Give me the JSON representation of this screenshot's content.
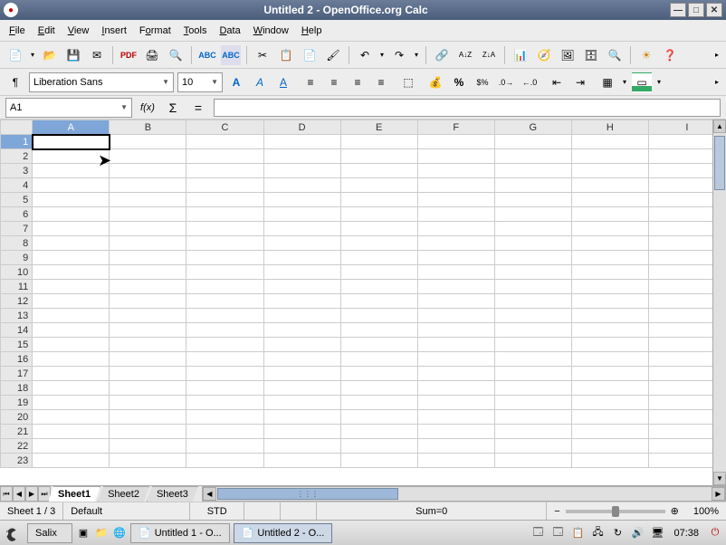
{
  "window": {
    "title": "Untitled 2 - OpenOffice.org Calc"
  },
  "menu": {
    "items": [
      "File",
      "Edit",
      "View",
      "Insert",
      "Format",
      "Tools",
      "Data",
      "Window",
      "Help"
    ]
  },
  "format": {
    "font_name": "Liberation Sans",
    "font_size": "10"
  },
  "formula": {
    "cell_ref": "A1",
    "value": ""
  },
  "grid": {
    "columns": [
      "A",
      "B",
      "C",
      "D",
      "E",
      "F",
      "G",
      "H",
      "I"
    ],
    "rows": [
      1,
      2,
      3,
      4,
      5,
      6,
      7,
      8,
      9,
      10,
      11,
      12,
      13,
      14,
      15,
      16,
      17,
      18,
      19,
      20,
      21,
      22,
      23
    ],
    "selected_col": "A",
    "selected_row": 1
  },
  "sheet_tabs": [
    "Sheet1",
    "Sheet2",
    "Sheet3"
  ],
  "active_sheet": "Sheet1",
  "status": {
    "sheet_indicator": "Sheet 1 / 3",
    "style": "Default",
    "mode": "STD",
    "sum": "Sum=0",
    "zoom": "100%"
  },
  "taskbar": {
    "distro": "Salix",
    "tasks": [
      {
        "label": "Untitled 1 - O...",
        "active": false
      },
      {
        "label": "Untitled 2 - O...",
        "active": true
      }
    ],
    "clock": "07:38"
  }
}
